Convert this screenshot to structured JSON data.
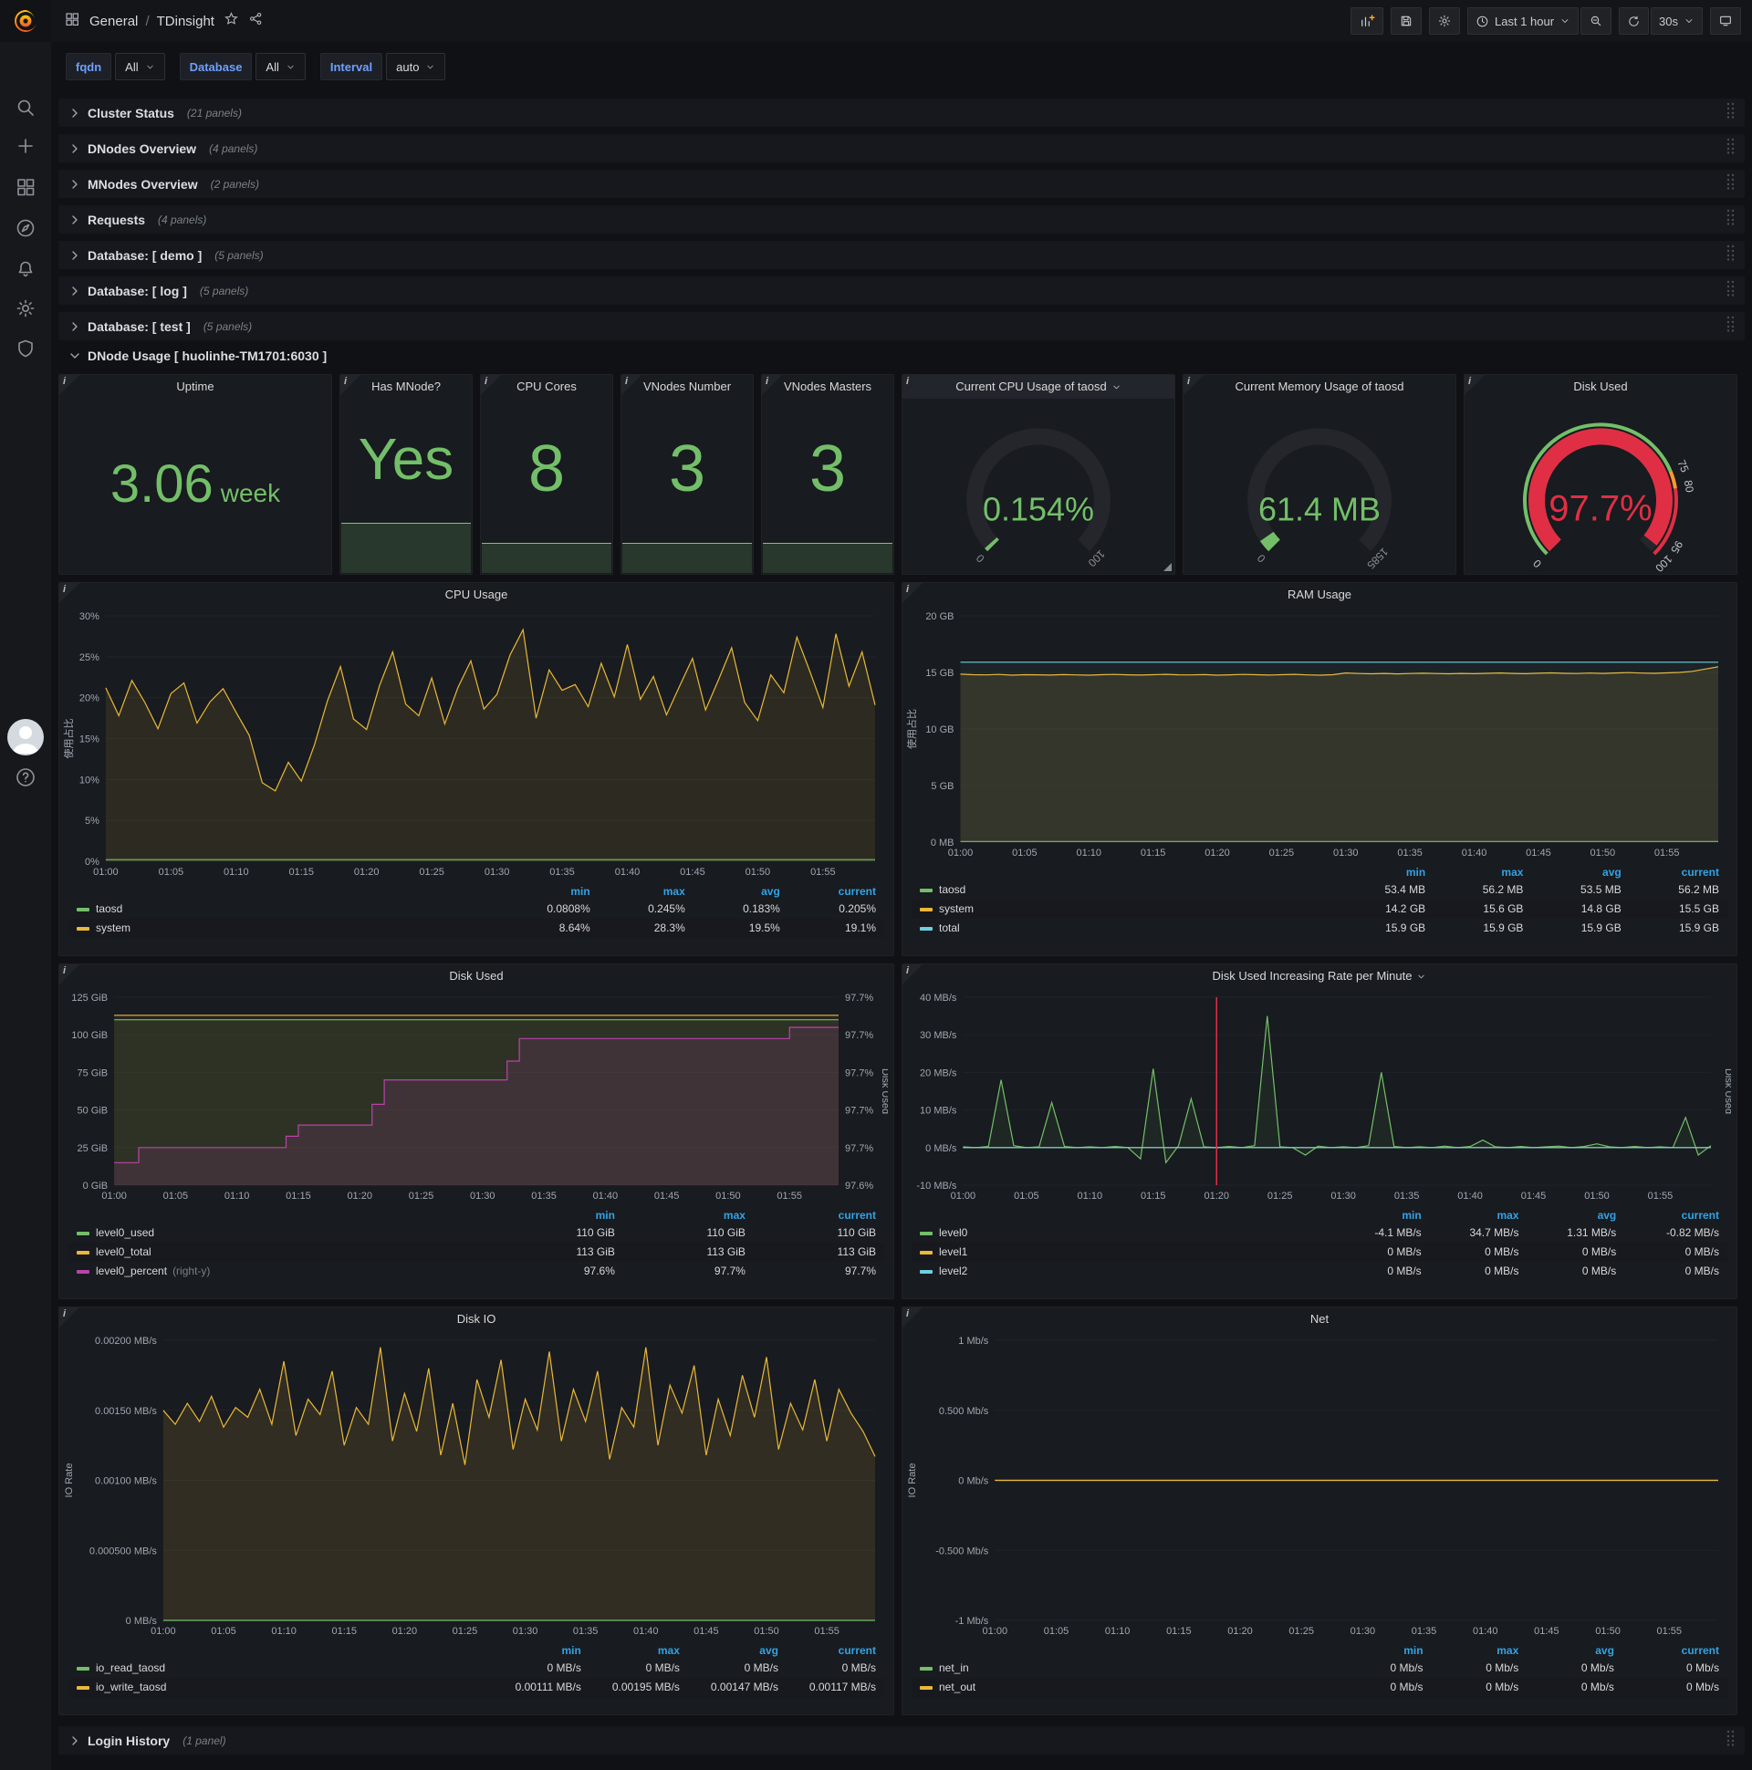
{
  "nav": {
    "breadcrumb": {
      "folder": "General",
      "separator": "/",
      "title": "TDinsight"
    },
    "time_range": "Last 1 hour",
    "refresh_interval": "30s"
  },
  "variables": [
    {
      "label": "fqdn",
      "value": "All"
    },
    {
      "label": "Database",
      "value": "All"
    },
    {
      "label": "Interval",
      "value": "auto"
    }
  ],
  "rows_top": [
    {
      "label": "Cluster Status",
      "count": "(21 panels)"
    },
    {
      "label": "DNodes Overview",
      "count": "(4 panels)"
    },
    {
      "label": "MNodes Overview",
      "count": "(2 panels)"
    },
    {
      "label": "Requests",
      "count": "(4 panels)"
    },
    {
      "label": "Database: [ demo ]",
      "count": "(5 panels)"
    },
    {
      "label": "Database: [ log ]",
      "count": "(5 panels)"
    },
    {
      "label": "Database: [ test ]",
      "count": "(5 panels)"
    }
  ],
  "expanded_row": {
    "label": "DNode Usage [ huolinhe-TM1701:6030 ]"
  },
  "bottom_row": {
    "label": "Login History",
    "count": "(1 panel)"
  },
  "stats": [
    {
      "title": "Uptime",
      "value": "3.06",
      "suffix": "week",
      "spark": 0,
      "value_size": 58,
      "suffix_size": 28
    },
    {
      "title": "Has MNode?",
      "value": "Yes",
      "suffix": "",
      "spark": 0.25,
      "value_size": 64,
      "suffix_size": 0
    },
    {
      "title": "CPU Cores",
      "value": "8",
      "suffix": "",
      "spark": 0.15,
      "value_size": 72,
      "suffix_size": 0
    },
    {
      "title": "VNodes Number",
      "value": "3",
      "suffix": "",
      "spark": 0.15,
      "value_size": 72,
      "suffix_size": 0
    },
    {
      "title": "VNodes Masters",
      "value": "3",
      "suffix": "",
      "spark": 0.15,
      "value_size": 72,
      "suffix_size": 0
    }
  ],
  "gauges": [
    {
      "title": "Current CPU Usage of taosd",
      "dropdown": true,
      "header_highlight": true,
      "resize_grip": true,
      "value": "0.154%",
      "fraction": 0.012,
      "min_label": "0",
      "max_label": "100",
      "value_color": "#73bf69",
      "arc_color": "#73bf69",
      "thresholds": null,
      "extra_labels": []
    },
    {
      "title": "Current Memory Usage of taosd",
      "dropdown": false,
      "header_highlight": false,
      "resize_grip": false,
      "value": "61.4 MB",
      "fraction": 0.039,
      "min_label": "0",
      "max_label": "1585",
      "value_color": "#73bf69",
      "arc_color": "#73bf69",
      "thresholds": null,
      "extra_labels": []
    },
    {
      "title": "Disk Used",
      "dropdown": false,
      "header_highlight": false,
      "resize_grip": false,
      "value": "97.7%",
      "fraction": 0.977,
      "min_label": "0",
      "max_label": "100",
      "value_color": "#e02f44",
      "arc_color": "#e02f44",
      "thresholds": [
        {
          "to": 0.75,
          "color": "#73bf69"
        },
        {
          "to": 0.8,
          "color": "#ff9830"
        },
        {
          "to": 1,
          "color": "#e02f44"
        }
      ],
      "extra_labels": [
        {
          "text": "75",
          "f": 0.75
        },
        {
          "text": "80",
          "f": 0.8
        },
        {
          "text": "95",
          "f": 0.95
        }
      ]
    }
  ],
  "chart_data": [
    {
      "type": "line",
      "title": "CPU Usage",
      "ylabel": "使用占比",
      "ylim": [
        0,
        30
      ],
      "yticks": [
        "0%",
        "5%",
        "10%",
        "15%",
        "20%",
        "25%",
        "30%"
      ],
      "xticks": [
        "01:00",
        "01:05",
        "01:10",
        "01:15",
        "01:20",
        "01:25",
        "01:30",
        "01:35",
        "01:40",
        "01:45",
        "01:50",
        "01:55"
      ],
      "series": [
        {
          "name": "system",
          "color": "#eab839",
          "fill": 0.1,
          "values": [
            21.2,
            17.8,
            22.1,
            19.4,
            16.2,
            20.5,
            21.8,
            16.9,
            19.5,
            21.1,
            18.2,
            15.4,
            9.6,
            8.6,
            12.1,
            9.8,
            14.2,
            19.6,
            23.8,
            17.4,
            16.1,
            21.5,
            25.6,
            19.2,
            17.8,
            22.4,
            16.8,
            21.2,
            24.5,
            18.6,
            20.4,
            25.2,
            28.3,
            17.5,
            23.4,
            20.9,
            21.6,
            18.9,
            24.2,
            20.1,
            26.5,
            19.8,
            22.6,
            17.9,
            21.4,
            24.8,
            18.5,
            22.2,
            26.1,
            19.4,
            17.2,
            22.8,
            20.6,
            27.4,
            23.2,
            18.8,
            27.8,
            21.4,
            25.6,
            19.1
          ]
        },
        {
          "name": "taosd",
          "color": "#73bf69",
          "fill": 0.1,
          "values": [
            0.2,
            0.2
          ]
        }
      ],
      "legend": {
        "cols": [
          "min",
          "max",
          "avg",
          "current"
        ],
        "rows": [
          {
            "name": "taosd",
            "color": "#73bf69",
            "note": "",
            "values": [
              "0.0808%",
              "0.245%",
              "0.183%",
              "0.205%"
            ]
          },
          {
            "name": "system",
            "color": "#eab839",
            "note": "",
            "values": [
              "8.64%",
              "28.3%",
              "19.5%",
              "19.1%"
            ]
          }
        ]
      }
    },
    {
      "type": "line",
      "title": "RAM Usage",
      "ylabel": "使用占比",
      "ylim": [
        0,
        20
      ],
      "yticks": [
        "0 MB",
        "5 GB",
        "10 GB",
        "15 GB",
        "20 GB"
      ],
      "xticks": [
        "01:00",
        "01:05",
        "01:10",
        "01:15",
        "01:20",
        "01:25",
        "01:30",
        "01:35",
        "01:40",
        "01:45",
        "01:50",
        "01:55"
      ],
      "series": [
        {
          "name": "system",
          "color": "#eab839",
          "fill": 0.12,
          "values": [
            14.85,
            14.8,
            14.78,
            14.82,
            14.76,
            14.8,
            14.79,
            14.77,
            14.81,
            14.78,
            14.76,
            14.8,
            14.82,
            14.79,
            14.77,
            14.8,
            14.83,
            14.79,
            14.78,
            14.81,
            14.76,
            14.79,
            14.82,
            14.8,
            14.77,
            14.8,
            14.83,
            14.78,
            14.76,
            14.8,
            14.95,
            14.9,
            14.88,
            14.91,
            14.87,
            14.9,
            14.93,
            14.9,
            14.88,
            14.91,
            14.89,
            14.92,
            14.95,
            14.91,
            14.89,
            14.93,
            14.96,
            14.92,
            14.9,
            14.94,
            14.91,
            14.95,
            14.98,
            14.94,
            14.92,
            14.96,
            15.0,
            15.1,
            15.3,
            15.5
          ]
        },
        {
          "name": "total",
          "color": "#6ed0e0",
          "fill": 0.05,
          "values": [
            15.9,
            15.9
          ]
        },
        {
          "name": "taosd",
          "color": "#73bf69",
          "fill": 0.1,
          "values": [
            0.055,
            0.055
          ]
        }
      ],
      "legend": {
        "cols": [
          "min",
          "max",
          "avg",
          "current"
        ],
        "rows": [
          {
            "name": "taosd",
            "color": "#73bf69",
            "note": "",
            "values": [
              "53.4 MB",
              "56.2 MB",
              "53.5 MB",
              "56.2 MB"
            ]
          },
          {
            "name": "system",
            "color": "#eab839",
            "note": "",
            "values": [
              "14.2 GB",
              "15.6 GB",
              "14.8 GB",
              "15.5 GB"
            ]
          },
          {
            "name": "total",
            "color": "#6ed0e0",
            "note": "",
            "values": [
              "15.9 GB",
              "15.9 GB",
              "15.9 GB",
              "15.9 GB"
            ]
          }
        ]
      }
    },
    {
      "type": "line",
      "title": "Disk Used",
      "ylabel": "",
      "ylim": [
        0,
        125
      ],
      "yticks": [
        "0 GiB",
        "25 GiB",
        "50 GiB",
        "75 GiB",
        "100 GiB",
        "125 GiB"
      ],
      "right_ylim": [
        97.64,
        97.74
      ],
      "right_ticks": [
        "97.6%",
        "97.7%",
        "97.7%",
        "97.7%",
        "97.7%",
        "97.7%"
      ],
      "right_label": "Disk Used",
      "xticks": [
        "01:00",
        "01:05",
        "01:10",
        "01:15",
        "01:20",
        "01:25",
        "01:30",
        "01:35",
        "01:40",
        "01:45",
        "01:50",
        "01:55"
      ],
      "series": [
        {
          "name": "level0_total",
          "color": "#eab839",
          "fill": 0.08,
          "values": [
            113,
            113
          ]
        },
        {
          "name": "level0_used",
          "color": "#73bf69",
          "fill": 0.08,
          "values": [
            110,
            110
          ]
        },
        {
          "name": "level0_percent",
          "color": "#ba43a9",
          "fill": 0.14,
          "axis": "right",
          "step": true,
          "values": [
            97.652,
            97.652,
            97.66,
            97.66,
            97.66,
            97.66,
            97.66,
            97.66,
            97.66,
            97.66,
            97.66,
            97.66,
            97.66,
            97.66,
            97.666,
            97.672,
            97.672,
            97.672,
            97.672,
            97.672,
            97.672,
            97.683,
            97.696,
            97.696,
            97.696,
            97.696,
            97.696,
            97.696,
            97.696,
            97.696,
            97.696,
            97.696,
            97.706,
            97.718,
            97.718,
            97.718,
            97.718,
            97.718,
            97.718,
            97.718,
            97.718,
            97.718,
            97.718,
            97.718,
            97.718,
            97.718,
            97.718,
            97.718,
            97.718,
            97.718,
            97.718,
            97.718,
            97.718,
            97.718,
            97.718,
            97.724,
            97.724,
            97.724,
            97.724,
            97.724
          ]
        }
      ],
      "legend": {
        "cols": [
          "min",
          "max",
          "current"
        ],
        "rows": [
          {
            "name": "level0_used",
            "color": "#73bf69",
            "note": "",
            "values": [
              "110 GiB",
              "110 GiB",
              "110 GiB"
            ]
          },
          {
            "name": "level0_total",
            "color": "#eab839",
            "note": "",
            "values": [
              "113 GiB",
              "113 GiB",
              "113 GiB"
            ]
          },
          {
            "name": "level0_percent",
            "color": "#ba43a9",
            "note": "(right-y)",
            "values": [
              "97.6%",
              "97.7%",
              "97.7%"
            ]
          }
        ]
      }
    },
    {
      "type": "line",
      "title": "Disk Used Increasing Rate per Minute",
      "dropdown": true,
      "ylabel": "",
      "ylim": [
        -10,
        40
      ],
      "yticks": [
        "-10 MB/s",
        "0 MB/s",
        "10 MB/s",
        "20 MB/s",
        "30 MB/s",
        "40 MB/s"
      ],
      "right_label": "Disk Used",
      "annotation_minute": 20,
      "xticks": [
        "01:00",
        "01:05",
        "01:10",
        "01:15",
        "01:20",
        "01:25",
        "01:30",
        "01:35",
        "01:40",
        "01:45",
        "01:50",
        "01:55"
      ],
      "series": [
        {
          "name": "level0",
          "color": "#73bf69",
          "fill": 0.08,
          "values": [
            0.2,
            0,
            0.3,
            18,
            0.5,
            0,
            0.2,
            12,
            0.3,
            0,
            0.2,
            0,
            0.3,
            0,
            -3,
            21,
            -4,
            0.5,
            13,
            0.2,
            0,
            0.3,
            0,
            0.5,
            35,
            0.2,
            0,
            -2,
            0.4,
            0,
            0.2,
            0,
            0.5,
            20,
            0.3,
            0,
            0.2,
            0,
            0.4,
            0,
            0.3,
            2,
            0.2,
            0,
            0.3,
            0,
            0.2,
            0.4,
            0,
            0.3,
            1,
            0.2,
            0,
            0.3,
            0,
            0.2,
            0,
            8,
            -2,
            0.5
          ]
        },
        {
          "name": "level1",
          "color": "#eab839",
          "fill": 0,
          "values": [
            0,
            0
          ]
        },
        {
          "name": "level2",
          "color": "#6ed0e0",
          "fill": 0,
          "values": [
            0,
            0
          ]
        }
      ],
      "legend": {
        "cols": [
          "min",
          "max",
          "avg",
          "current"
        ],
        "rows": [
          {
            "name": "level0",
            "color": "#73bf69",
            "note": "",
            "values": [
              "-4.1 MB/s",
              "34.7 MB/s",
              "1.31 MB/s",
              "-0.82 MB/s"
            ]
          },
          {
            "name": "level1",
            "color": "#eab839",
            "note": "",
            "values": [
              "0 MB/s",
              "0 MB/s",
              "0 MB/s",
              "0 MB/s"
            ]
          },
          {
            "name": "level2",
            "color": "#6ed0e0",
            "note": "",
            "values": [
              "0 MB/s",
              "0 MB/s",
              "0 MB/s",
              "0 MB/s"
            ]
          }
        ]
      }
    },
    {
      "type": "line",
      "title": "Disk IO",
      "ylabel": "IO Rate",
      "ylim": [
        0,
        0.002
      ],
      "yticks": [
        "0 MB/s",
        "0.000500 MB/s",
        "0.00100 MB/s",
        "0.00150 MB/s",
        "0.00200 MB/s"
      ],
      "xticks": [
        "01:00",
        "01:05",
        "01:10",
        "01:15",
        "01:20",
        "01:25",
        "01:30",
        "01:35",
        "01:40",
        "01:45",
        "01:50",
        "01:55"
      ],
      "series": [
        {
          "name": "io_write_taosd",
          "color": "#eab839",
          "fill": 0.12,
          "values": [
            0.0015,
            0.0014,
            0.00155,
            0.00142,
            0.0016,
            0.00138,
            0.00152,
            0.00145,
            0.00165,
            0.0014,
            0.00185,
            0.00132,
            0.00158,
            0.00147,
            0.00178,
            0.00125,
            0.00152,
            0.0014,
            0.00195,
            0.00128,
            0.00162,
            0.00135,
            0.0018,
            0.00118,
            0.00155,
            0.00111,
            0.00172,
            0.00145,
            0.00186,
            0.00122,
            0.00158,
            0.00136,
            0.00192,
            0.00128,
            0.00165,
            0.00142,
            0.00178,
            0.00115,
            0.00152,
            0.00138,
            0.00195,
            0.00125,
            0.00168,
            0.00148,
            0.00182,
            0.00118,
            0.00158,
            0.00132,
            0.00175,
            0.00145,
            0.00188,
            0.00122,
            0.00155,
            0.00136,
            0.00172,
            0.00128,
            0.00165,
            0.00148,
            0.00135,
            0.00117
          ]
        },
        {
          "name": "io_read_taosd",
          "color": "#73bf69",
          "fill": 0.1,
          "values": [
            0,
            0
          ]
        }
      ],
      "legend": {
        "cols": [
          "min",
          "max",
          "avg",
          "current"
        ],
        "rows": [
          {
            "name": "io_read_taosd",
            "color": "#73bf69",
            "note": "",
            "values": [
              "0 MB/s",
              "0 MB/s",
              "0 MB/s",
              "0 MB/s"
            ]
          },
          {
            "name": "io_write_taosd",
            "color": "#eab839",
            "note": "",
            "values": [
              "0.00111 MB/s",
              "0.00195 MB/s",
              "0.00147 MB/s",
              "0.00117 MB/s"
            ]
          }
        ]
      }
    },
    {
      "type": "line",
      "title": "Net",
      "ylabel": "IO Rate",
      "ylim": [
        -1,
        1
      ],
      "yticks": [
        "-1 Mb/s",
        "-0.500 Mb/s",
        "0 Mb/s",
        "0.500 Mb/s",
        "1 Mb/s"
      ],
      "xticks": [
        "01:00",
        "01:05",
        "01:10",
        "01:15",
        "01:20",
        "01:25",
        "01:30",
        "01:35",
        "01:40",
        "01:45",
        "01:50",
        "01:55"
      ],
      "series": [
        {
          "name": "net_in",
          "color": "#73bf69",
          "fill": 0,
          "values": [
            0,
            0
          ]
        },
        {
          "name": "net_out",
          "color": "#eab839",
          "fill": 0,
          "values": [
            0,
            0
          ]
        }
      ],
      "legend": {
        "cols": [
          "min",
          "max",
          "avg",
          "current"
        ],
        "rows": [
          {
            "name": "net_in",
            "color": "#73bf69",
            "note": "",
            "values": [
              "0 Mb/s",
              "0 Mb/s",
              "0 Mb/s",
              "0 Mb/s"
            ]
          },
          {
            "name": "net_out",
            "color": "#eab839",
            "note": "",
            "values": [
              "0 Mb/s",
              "0 Mb/s",
              "0 Mb/s",
              "0 Mb/s"
            ]
          }
        ]
      }
    }
  ]
}
